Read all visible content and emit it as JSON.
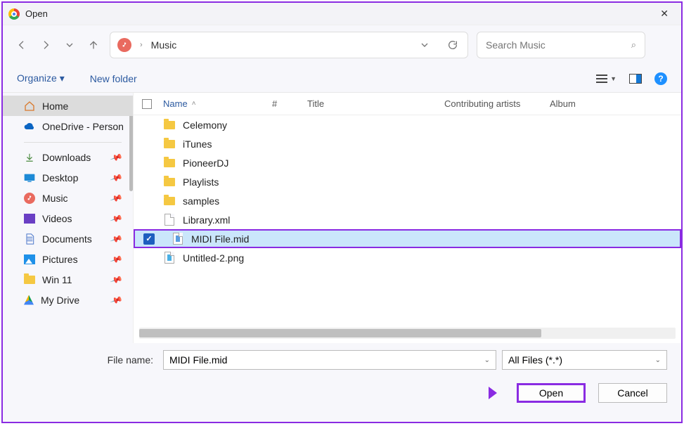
{
  "titlebar": {
    "title": "Open"
  },
  "address": {
    "location": "Music",
    "dropdown_hint": "▾"
  },
  "search": {
    "placeholder": "Search Music"
  },
  "toolbar": {
    "organize": "Organize ▾",
    "newfolder": "New folder",
    "help": "?"
  },
  "sidebar": {
    "items": [
      {
        "label": "Home"
      },
      {
        "label": "OneDrive - Person"
      },
      {
        "label": "Downloads"
      },
      {
        "label": "Desktop"
      },
      {
        "label": "Music"
      },
      {
        "label": "Videos"
      },
      {
        "label": "Documents"
      },
      {
        "label": "Pictures"
      },
      {
        "label": "Win 11"
      },
      {
        "label": "My Drive"
      }
    ]
  },
  "columns": {
    "name": "Name",
    "num": "#",
    "title": "Title",
    "artists": "Contributing artists",
    "album": "Album"
  },
  "files": {
    "items": [
      {
        "name": "Celemony"
      },
      {
        "name": "iTunes"
      },
      {
        "name": "PioneerDJ"
      },
      {
        "name": "Playlists"
      },
      {
        "name": "samples"
      },
      {
        "name": "Library.xml"
      },
      {
        "name": "MIDI File.mid"
      },
      {
        "name": "Untitled-2.png"
      }
    ]
  },
  "footer": {
    "filename_label": "File name:",
    "filename_value": "MIDI File.mid",
    "filter": "All Files (*.*)",
    "open": "Open",
    "cancel": "Cancel"
  }
}
